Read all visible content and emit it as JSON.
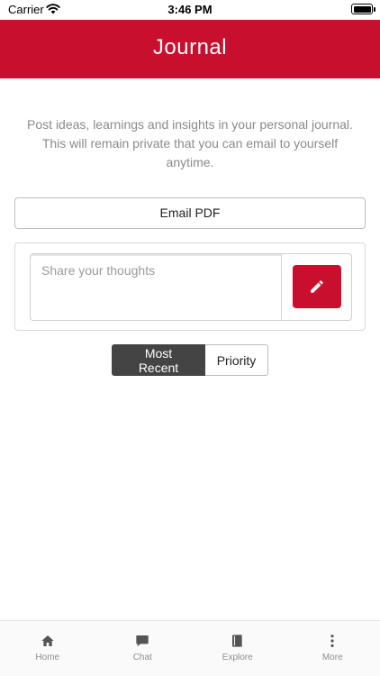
{
  "status_bar": {
    "carrier": "Carrier",
    "time": "3:46 PM"
  },
  "header": {
    "title": "Journal"
  },
  "intro": {
    "text": "Post ideas, learnings and insights in your personal journal. This will remain private that you can email to yourself anytime."
  },
  "actions": {
    "email_pdf_label": "Email PDF"
  },
  "compose": {
    "placeholder": "Share your thoughts",
    "value": ""
  },
  "sort": {
    "options": [
      "Most Recent",
      "Priority"
    ],
    "selected": "Most Recent"
  },
  "tabbar": {
    "items": [
      {
        "label": "Home",
        "icon": "home-icon"
      },
      {
        "label": "Chat",
        "icon": "chat-icon"
      },
      {
        "label": "Explore",
        "icon": "book-icon"
      },
      {
        "label": "More",
        "icon": "more-vertical-icon"
      }
    ]
  },
  "colors": {
    "brand": "#c8102e",
    "segment_active": "#444444",
    "muted_text": "#8a8a8a"
  }
}
